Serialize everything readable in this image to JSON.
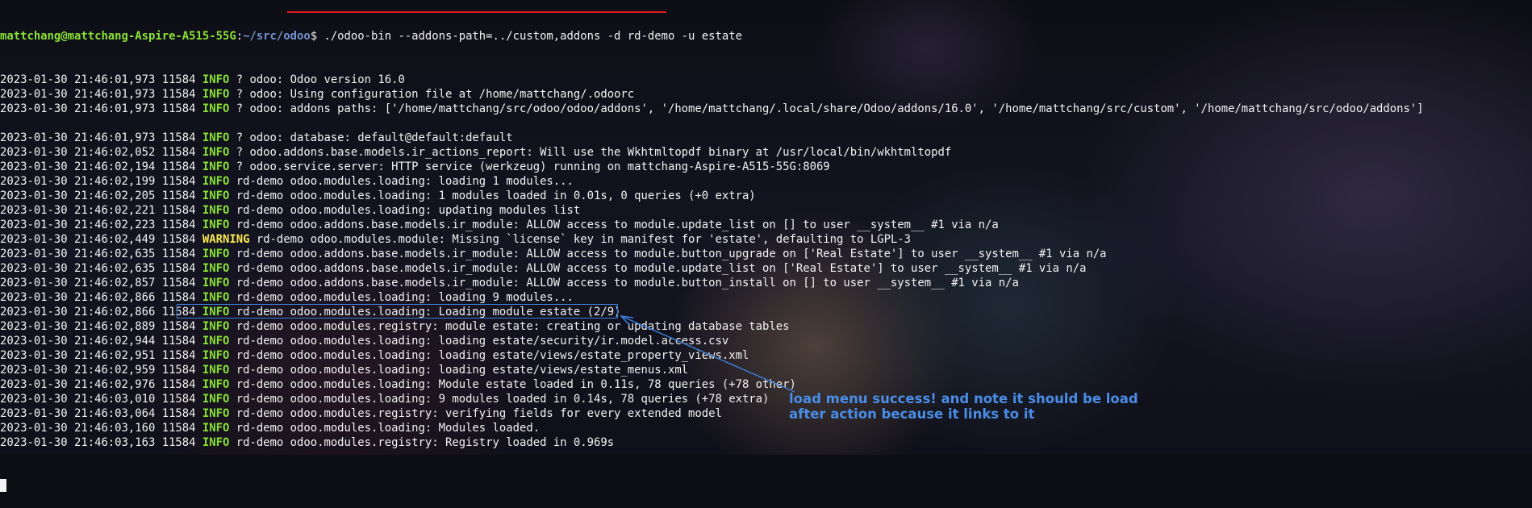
{
  "prompt": {
    "user_host": "mattchang@mattchang-Aspire-A515-55G",
    "path": "~/src/odoo",
    "command": "./odoo-bin --addons-path=../custom,addons -d rd-demo -u estate"
  },
  "log_lines": [
    {
      "ts": "2023-01-30 21:46:01,973 11584",
      "level": "INFO",
      "msg": "? odoo: Odoo version 16.0"
    },
    {
      "ts": "2023-01-30 21:46:01,973 11584",
      "level": "INFO",
      "msg": "? odoo: Using configuration file at /home/mattchang/.odoorc"
    },
    {
      "ts": "2023-01-30 21:46:01,973 11584",
      "level": "INFO",
      "msg": "? odoo: addons paths: ['/home/mattchang/src/odoo/odoo/addons', '/home/mattchang/.local/share/Odoo/addons/16.0', '/home/mattchang/src/custom', '/home/mattchang/src/odoo/addons']"
    },
    {
      "ts": "",
      "level": "",
      "msg": ""
    },
    {
      "ts": "2023-01-30 21:46:01,973 11584",
      "level": "INFO",
      "msg": "? odoo: database: default@default:default"
    },
    {
      "ts": "2023-01-30 21:46:02,052 11584",
      "level": "INFO",
      "msg": "? odoo.addons.base.models.ir_actions_report: Will use the Wkhtmltopdf binary at /usr/local/bin/wkhtmltopdf"
    },
    {
      "ts": "2023-01-30 21:46:02,194 11584",
      "level": "INFO",
      "msg": "? odoo.service.server: HTTP service (werkzeug) running on mattchang-Aspire-A515-55G:8069"
    },
    {
      "ts": "2023-01-30 21:46:02,199 11584",
      "level": "INFO",
      "msg": "rd-demo odoo.modules.loading: loading 1 modules..."
    },
    {
      "ts": "2023-01-30 21:46:02,205 11584",
      "level": "INFO",
      "msg": "rd-demo odoo.modules.loading: 1 modules loaded in 0.01s, 0 queries (+0 extra)"
    },
    {
      "ts": "2023-01-30 21:46:02,221 11584",
      "level": "INFO",
      "msg": "rd-demo odoo.modules.loading: updating modules list"
    },
    {
      "ts": "2023-01-30 21:46:02,223 11584",
      "level": "INFO",
      "msg": "rd-demo odoo.addons.base.models.ir_module: ALLOW access to module.update_list on [] to user __system__ #1 via n/a"
    },
    {
      "ts": "2023-01-30 21:46:02,449 11584",
      "level": "WARNING",
      "msg": "rd-demo odoo.modules.module: Missing `license` key in manifest for 'estate', defaulting to LGPL-3"
    },
    {
      "ts": "2023-01-30 21:46:02,635 11584",
      "level": "INFO",
      "msg": "rd-demo odoo.addons.base.models.ir_module: ALLOW access to module.button_upgrade on ['Real Estate'] to user __system__ #1 via n/a"
    },
    {
      "ts": "2023-01-30 21:46:02,635 11584",
      "level": "INFO",
      "msg": "rd-demo odoo.addons.base.models.ir_module: ALLOW access to module.update_list on ['Real Estate'] to user __system__ #1 via n/a"
    },
    {
      "ts": "2023-01-30 21:46:02,857 11584",
      "level": "INFO",
      "msg": "rd-demo odoo.addons.base.models.ir_module: ALLOW access to module.button_install on [] to user __system__ #1 via n/a"
    },
    {
      "ts": "2023-01-30 21:46:02,866 11584",
      "level": "INFO",
      "msg": "rd-demo odoo.modules.loading: loading 9 modules..."
    },
    {
      "ts": "2023-01-30 21:46:02,866 11584",
      "level": "INFO",
      "msg": "rd-demo odoo.modules.loading: Loading module estate (2/9)"
    },
    {
      "ts": "2023-01-30 21:46:02,889 11584",
      "level": "INFO",
      "msg": "rd-demo odoo.modules.registry: module estate: creating or updating database tables"
    },
    {
      "ts": "2023-01-30 21:46:02,944 11584",
      "level": "INFO",
      "msg": "rd-demo odoo.modules.loading: loading estate/security/ir.model.access.csv"
    },
    {
      "ts": "2023-01-30 21:46:02,951 11584",
      "level": "INFO",
      "msg": "rd-demo odoo.modules.loading: loading estate/views/estate_property_views.xml"
    },
    {
      "ts": "2023-01-30 21:46:02,959 11584",
      "level": "INFO",
      "msg": "rd-demo odoo.modules.loading: loading estate/views/estate_menus.xml"
    },
    {
      "ts": "2023-01-30 21:46:02,976 11584",
      "level": "INFO",
      "msg": "rd-demo odoo.modules.loading: Module estate loaded in 0.11s, 78 queries (+78 other)"
    },
    {
      "ts": "2023-01-30 21:46:03,010 11584",
      "level": "INFO",
      "msg": "rd-demo odoo.modules.loading: 9 modules loaded in 0.14s, 78 queries (+78 extra)"
    },
    {
      "ts": "2023-01-30 21:46:03,064 11584",
      "level": "INFO",
      "msg": "rd-demo odoo.modules.registry: verifying fields for every extended model"
    },
    {
      "ts": "2023-01-30 21:46:03,160 11584",
      "level": "INFO",
      "msg": "rd-demo odoo.modules.loading: Modules loaded."
    },
    {
      "ts": "2023-01-30 21:46:03,163 11584",
      "level": "INFO",
      "msg": "rd-demo odoo.modules.registry: Registry loaded in 0.969s"
    }
  ],
  "annotation": {
    "line1": "load menu success! and note it should be load",
    "line2": "after action because it links to it"
  },
  "colors": {
    "user_host": "#8ae234",
    "path": "#7294cf",
    "info": "#8ae234",
    "warning": "#fce94f",
    "text": "#f2f2f2",
    "underline": "#e01b24",
    "annotation": "#4a8de6"
  },
  "highlighted_line_index": 20
}
